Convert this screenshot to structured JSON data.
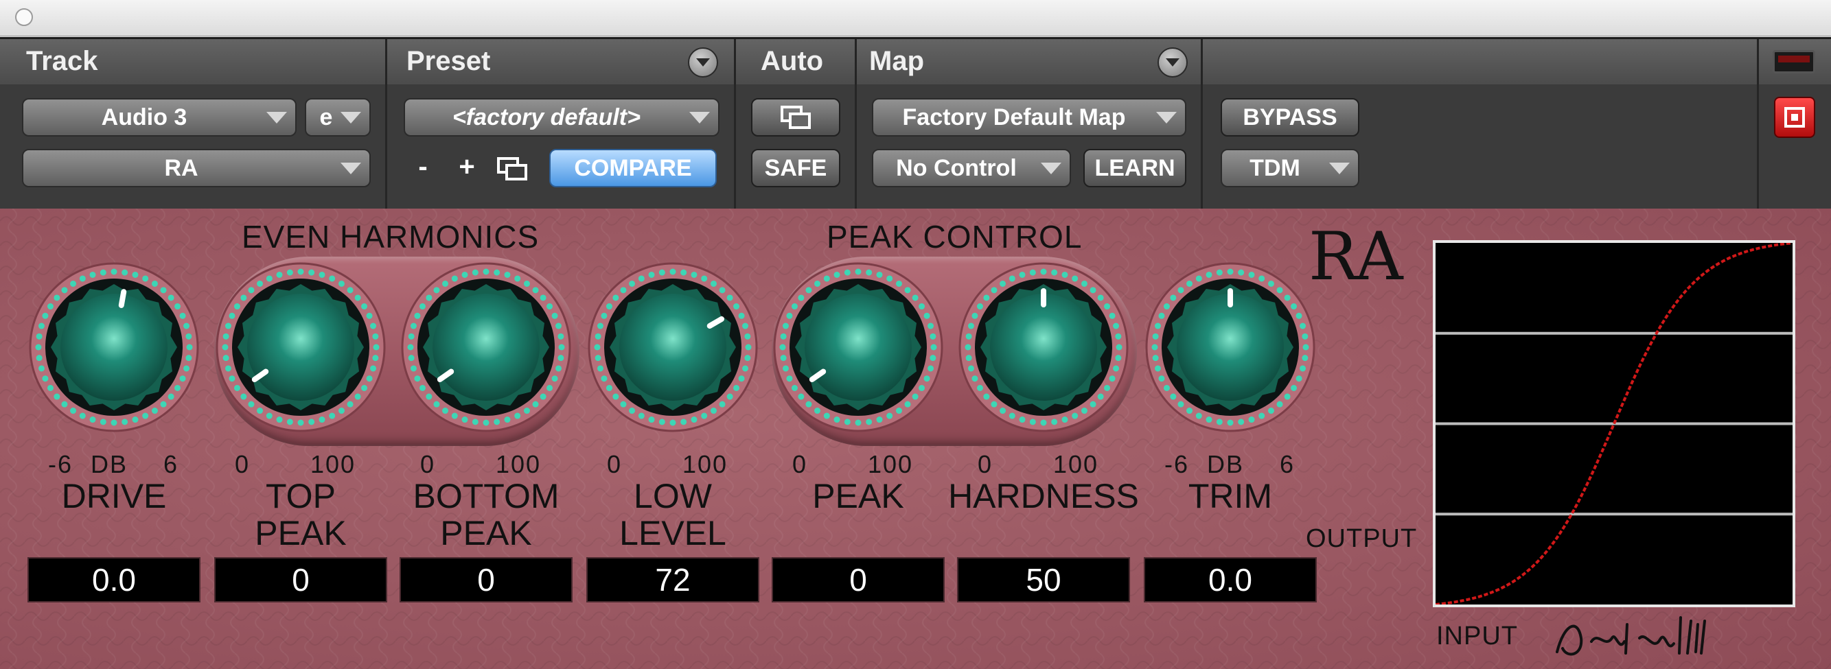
{
  "window": {
    "button_icon": "circle"
  },
  "header": {
    "track": {
      "title": "Track",
      "name": "Audio 3",
      "channel": "e",
      "insert": "RA"
    },
    "preset": {
      "title": "Preset",
      "current": "<factory default>",
      "minus": "-",
      "plus": "+",
      "compare": "COMPARE"
    },
    "auto": {
      "title": "Auto",
      "safe": "SAFE"
    },
    "map": {
      "title": "Map",
      "current": "Factory Default Map",
      "control": "No Control",
      "learn": "LEARN"
    },
    "extra": {
      "bypass": "BYPASS",
      "format": "TDM"
    }
  },
  "plugin": {
    "name": "RA",
    "group_even": "EVEN HARMONICS",
    "group_peak": "PEAK CONTROL",
    "colors": {
      "panel": "#9b5863",
      "knob": "#1f8c78",
      "dots": "#3dd6b5",
      "curve": "#d01818"
    },
    "knobs": [
      {
        "scale_left": "-6",
        "scale_mid": "DB",
        "scale_right": "6",
        "line1": "DRIVE",
        "line2": "",
        "value": "0.0",
        "angle": 10
      },
      {
        "scale_left": "0",
        "scale_mid": "",
        "scale_right": "100",
        "line1": "TOP",
        "line2": "PEAK",
        "value": "0",
        "angle": 235
      },
      {
        "scale_left": "0",
        "scale_mid": "",
        "scale_right": "100",
        "line1": "BOTTOM",
        "line2": "PEAK",
        "value": "0",
        "angle": 235
      },
      {
        "scale_left": "0",
        "scale_mid": "",
        "scale_right": "100",
        "line1": "LOW",
        "line2": "LEVEL",
        "value": "72",
        "angle": 60
      },
      {
        "scale_left": "0",
        "scale_mid": "",
        "scale_right": "100",
        "line1": "PEAK",
        "line2": "",
        "value": "0",
        "angle": 235
      },
      {
        "scale_left": "0",
        "scale_mid": "",
        "scale_right": "100",
        "line1": "HARDNESS",
        "line2": "",
        "value": "50",
        "angle": 0
      },
      {
        "scale_left": "-6",
        "scale_mid": "DB",
        "scale_right": "6",
        "line1": "TRIM",
        "line2": "",
        "value": "0.0",
        "angle": 0
      }
    ],
    "graph": {
      "x_label": "INPUT",
      "y_label": "OUTPUT"
    }
  }
}
